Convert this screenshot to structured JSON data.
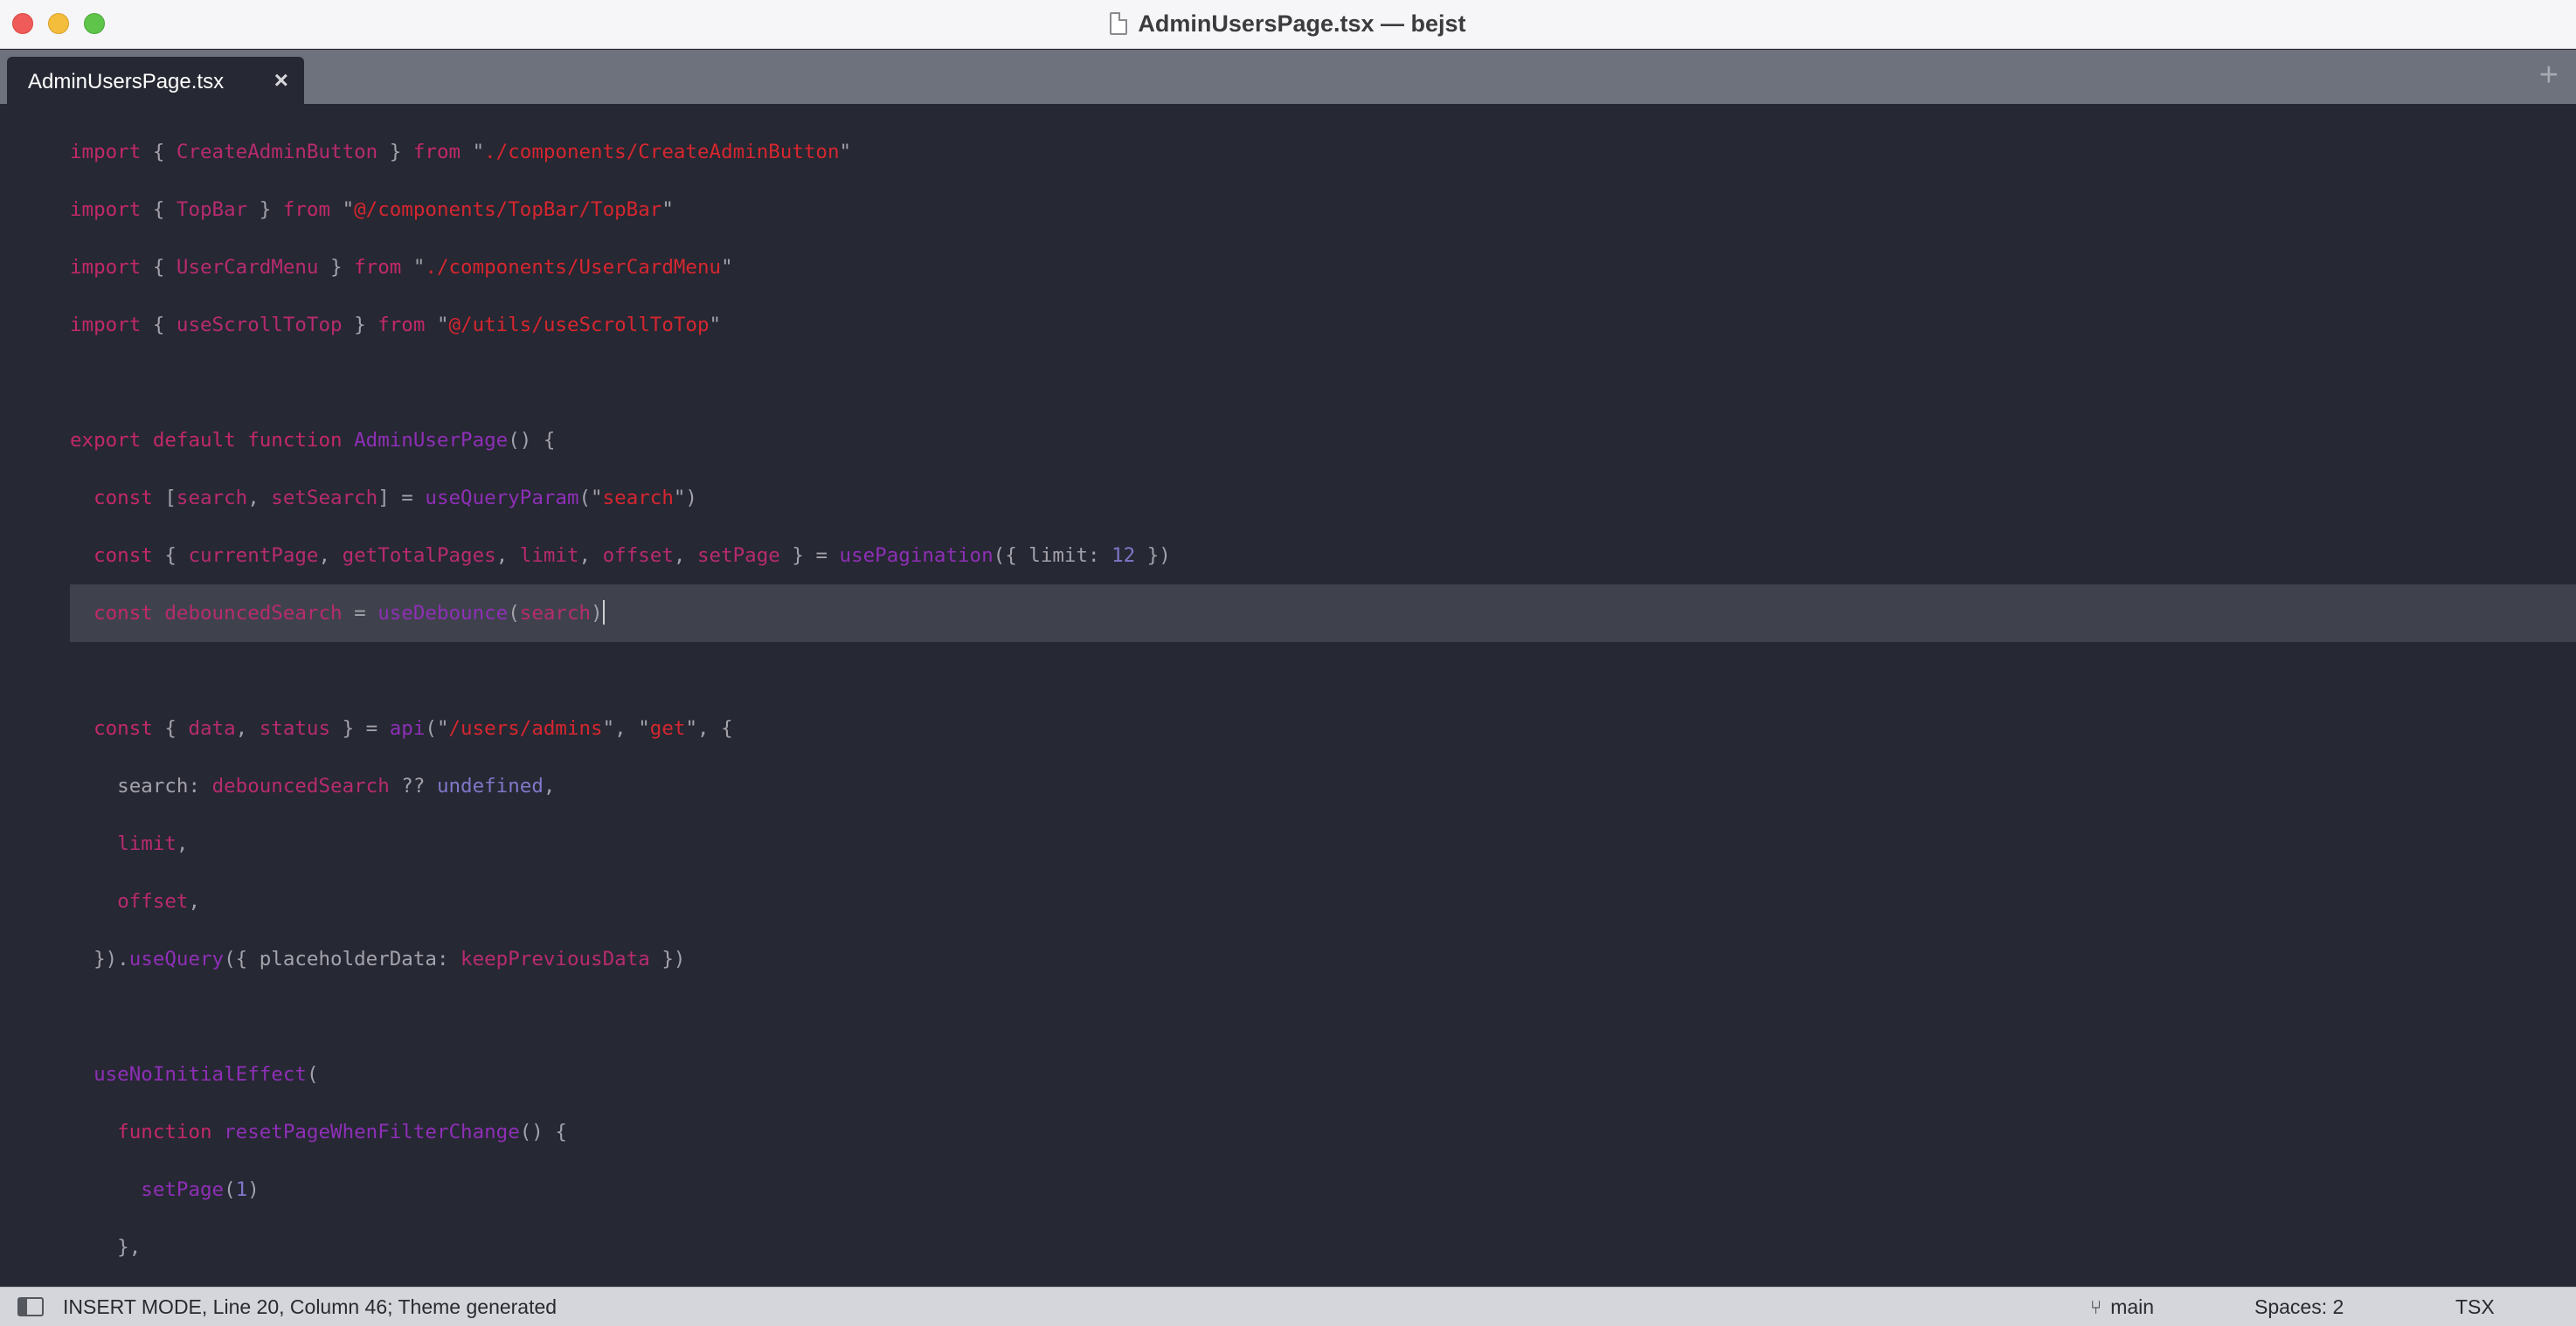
{
  "window": {
    "title": "AdminUsersPage.tsx — bejst"
  },
  "tabs": [
    {
      "label": "AdminUsersPage.tsx",
      "close": "×"
    }
  ],
  "tab_add": "+",
  "editor": {
    "lines": [
      {
        "tokens": [
          [
            "kw",
            "import"
          ],
          [
            "plain",
            " { "
          ],
          [
            "id",
            "CreateAdminButton"
          ],
          [
            "plain",
            " } "
          ],
          [
            "kw",
            "from"
          ],
          [
            "plain",
            " \""
          ],
          [
            "str",
            "./components/CreateAdminButton"
          ],
          [
            "plain",
            "\""
          ]
        ]
      },
      {
        "tokens": [
          [
            "kw",
            "import"
          ],
          [
            "plain",
            " { "
          ],
          [
            "id",
            "TopBar"
          ],
          [
            "plain",
            " } "
          ],
          [
            "kw",
            "from"
          ],
          [
            "plain",
            " \""
          ],
          [
            "str",
            "@/components/TopBar/TopBar"
          ],
          [
            "plain",
            "\""
          ]
        ]
      },
      {
        "tokens": [
          [
            "kw",
            "import"
          ],
          [
            "plain",
            " { "
          ],
          [
            "id",
            "UserCardMenu"
          ],
          [
            "plain",
            " } "
          ],
          [
            "kw",
            "from"
          ],
          [
            "plain",
            " \""
          ],
          [
            "str",
            "./components/UserCardMenu"
          ],
          [
            "plain",
            "\""
          ]
        ]
      },
      {
        "tokens": [
          [
            "kw",
            "import"
          ],
          [
            "plain",
            " { "
          ],
          [
            "id",
            "useScrollToTop"
          ],
          [
            "plain",
            " } "
          ],
          [
            "kw",
            "from"
          ],
          [
            "plain",
            " \""
          ],
          [
            "str",
            "@/utils/useScrollToTop"
          ],
          [
            "plain",
            "\""
          ]
        ]
      },
      {
        "tokens": []
      },
      {
        "tokens": [
          [
            "kw",
            "export default function"
          ],
          [
            "plain",
            " "
          ],
          [
            "fn",
            "AdminUserPage"
          ],
          [
            "plain",
            "() {"
          ]
        ]
      },
      {
        "tokens": [
          [
            "plain",
            "  "
          ],
          [
            "kw",
            "const"
          ],
          [
            "plain",
            " ["
          ],
          [
            "id",
            "search"
          ],
          [
            "plain",
            ", "
          ],
          [
            "id",
            "setSearch"
          ],
          [
            "plain",
            "] = "
          ],
          [
            "fn",
            "useQueryParam"
          ],
          [
            "plain",
            "(\""
          ],
          [
            "str",
            "search"
          ],
          [
            "plain",
            "\")"
          ]
        ]
      },
      {
        "tokens": [
          [
            "plain",
            "  "
          ],
          [
            "kw",
            "const"
          ],
          [
            "plain",
            " { "
          ],
          [
            "id",
            "currentPage"
          ],
          [
            "plain",
            ", "
          ],
          [
            "id",
            "getTotalPages"
          ],
          [
            "plain",
            ", "
          ],
          [
            "id",
            "limit"
          ],
          [
            "plain",
            ", "
          ],
          [
            "id",
            "offset"
          ],
          [
            "plain",
            ", "
          ],
          [
            "id",
            "setPage"
          ],
          [
            "plain",
            " } = "
          ],
          [
            "fn",
            "usePagination"
          ],
          [
            "plain",
            "({ limit: "
          ],
          [
            "num",
            "12"
          ],
          [
            "plain",
            " })"
          ]
        ]
      },
      {
        "current": true,
        "tokens": [
          [
            "plain",
            "  "
          ],
          [
            "kw",
            "const"
          ],
          [
            "plain",
            " "
          ],
          [
            "id",
            "debouncedSearch"
          ],
          [
            "plain",
            " = "
          ],
          [
            "fn",
            "useDebounce"
          ],
          [
            "plain",
            "("
          ],
          [
            "id",
            "search"
          ],
          [
            "plain",
            ")"
          ]
        ]
      },
      {
        "tokens": []
      },
      {
        "tokens": [
          [
            "plain",
            "  "
          ],
          [
            "kw",
            "const"
          ],
          [
            "plain",
            " { "
          ],
          [
            "id",
            "data"
          ],
          [
            "plain",
            ", "
          ],
          [
            "id",
            "status"
          ],
          [
            "plain",
            " } = "
          ],
          [
            "fn",
            "api"
          ],
          [
            "plain",
            "(\""
          ],
          [
            "str",
            "/users/admins"
          ],
          [
            "plain",
            "\", \""
          ],
          [
            "str",
            "get"
          ],
          [
            "plain",
            "\", {"
          ]
        ]
      },
      {
        "tokens": [
          [
            "plain",
            "    search: "
          ],
          [
            "id",
            "debouncedSearch"
          ],
          [
            "plain",
            " ?? "
          ],
          [
            "num",
            "undefined"
          ],
          [
            "plain",
            ","
          ]
        ]
      },
      {
        "tokens": [
          [
            "plain",
            "    "
          ],
          [
            "id",
            "limit"
          ],
          [
            "plain",
            ","
          ]
        ]
      },
      {
        "tokens": [
          [
            "plain",
            "    "
          ],
          [
            "id",
            "offset"
          ],
          [
            "plain",
            ","
          ]
        ]
      },
      {
        "tokens": [
          [
            "plain",
            "  })."
          ],
          [
            "fn",
            "useQuery"
          ],
          [
            "plain",
            "({ placeholderData: "
          ],
          [
            "id",
            "keepPreviousData"
          ],
          [
            "plain",
            " })"
          ]
        ]
      },
      {
        "tokens": []
      },
      {
        "tokens": [
          [
            "plain",
            "  "
          ],
          [
            "fn",
            "useNoInitialEffect"
          ],
          [
            "plain",
            "("
          ]
        ]
      },
      {
        "tokens": [
          [
            "plain",
            "    "
          ],
          [
            "kw",
            "function"
          ],
          [
            "plain",
            " "
          ],
          [
            "fn",
            "resetPageWhenFilterChange"
          ],
          [
            "plain",
            "() {"
          ]
        ]
      },
      {
        "tokens": [
          [
            "plain",
            "      "
          ],
          [
            "fn",
            "setPage"
          ],
          [
            "plain",
            "("
          ],
          [
            "num",
            "1"
          ],
          [
            "plain",
            ")"
          ]
        ]
      },
      {
        "tokens": [
          [
            "plain",
            "    },"
          ]
        ]
      }
    ]
  },
  "statusbar": {
    "mode": "INSERT MODE, Line 20, Column 46; Theme generated",
    "branch": "main",
    "spaces": "Spaces: 2",
    "language": "TSX"
  }
}
